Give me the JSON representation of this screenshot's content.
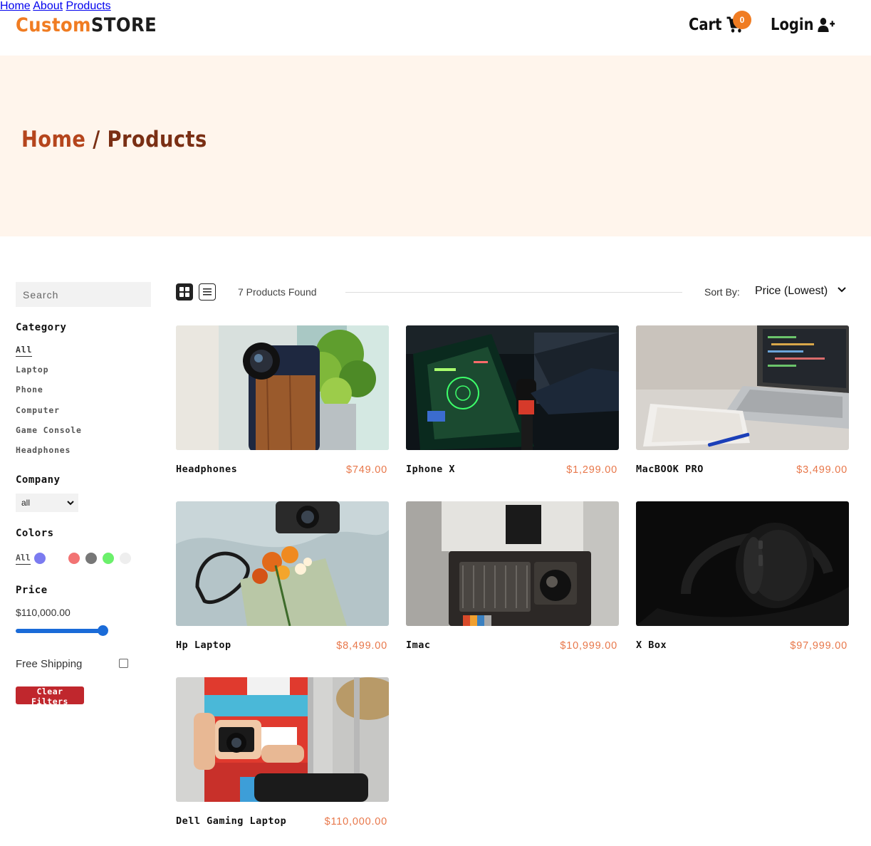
{
  "header": {
    "logo_a": "Custom",
    "logo_b": "STORE",
    "nav": [
      "Home",
      "About",
      "Products"
    ],
    "cart_label": "Cart",
    "cart_count": "0",
    "login_label": "Login"
  },
  "hero": {
    "crumb_home": "Home",
    "crumb_sep": " / ",
    "crumb_current": "Products"
  },
  "sidebar": {
    "search_placeholder": "Search",
    "category_heading": "Category",
    "categories": [
      "All",
      "Laptop",
      "Phone",
      "Computer",
      "Game Console",
      "Headphones"
    ],
    "company_heading": "Company",
    "company_selected": "all",
    "colors_heading": "Colors",
    "colors_all": "All",
    "colors": [
      "#7b7bf0",
      "#f27373",
      "#777777",
      "#6bf06b",
      "#eeeeee"
    ],
    "price_heading": "Price",
    "price_value": "$110,000.00",
    "price_fraction": 1.0,
    "shipping_label": "Free Shipping",
    "clear_label": "Clear Filters"
  },
  "toolbar": {
    "found_text": "7 Products Found",
    "sort_label": "Sort By:",
    "sort_value": "Price (Lowest)"
  },
  "products": [
    {
      "name": "Headphones",
      "price": "$749.00"
    },
    {
      "name": "Iphone X",
      "price": "$1,299.00"
    },
    {
      "name": "MacBOOK PRO",
      "price": "$3,499.00"
    },
    {
      "name": "Hp Laptop",
      "price": "$8,499.00"
    },
    {
      "name": "Imac",
      "price": "$10,999.00"
    },
    {
      "name": "X Box",
      "price": "$97,999.00"
    },
    {
      "name": "Dell Gaming Laptop",
      "price": "$110,000.00"
    }
  ]
}
